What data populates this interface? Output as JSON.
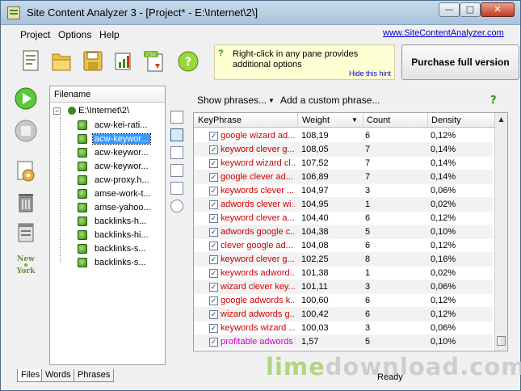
{
  "window": {
    "title": "Site Content Analyzer 3 - [Project* - E:\\Internet\\2\\]",
    "buttons": {
      "minimize": "—",
      "maximize": "□",
      "close": "✕"
    }
  },
  "menu": {
    "items": [
      "Project",
      "Options",
      "Help"
    ],
    "site_link": "www.SiteContentAnalyzer.com"
  },
  "toolbar": {
    "icons": [
      "new-project-icon",
      "open-folder-icon",
      "save-icon",
      "reports-icon",
      "export-csv-icon",
      "help-icon"
    ],
    "help_glyph": "?"
  },
  "hint": {
    "text": "Right-click in any pane provides additional options",
    "hide_label": "Hide this hint",
    "icon": "?"
  },
  "purchase_label": "Purchase full version",
  "left_toolbar": {
    "icons": [
      "play-icon",
      "stop-icon",
      "settings-icon",
      "trash-icon",
      "list-icon",
      "new-york-icon"
    ],
    "ny_label_1": "New",
    "ny_label_2": "York"
  },
  "file_pane": {
    "header": "Filename",
    "root": "E:\\Internet\\2\\",
    "files": [
      "acw-kei-rati...",
      "acw-keywor...",
      "acw-keywor...",
      "acw-keywor...",
      "acw-proxy.h...",
      "amse-work-t...",
      "amse-yahoo...",
      "backlinks-h...",
      "backlinks-hi...",
      "backlinks-s...",
      "backlinks-s..."
    ],
    "selected_index": 1
  },
  "bottom_tabs": [
    "Files",
    "Words",
    "Phrases"
  ],
  "phrases": {
    "show_label": "Show phrases...",
    "add_label": "Add a custom phrase...",
    "help": "?",
    "columns": [
      "KeyPhrase",
      "Weight",
      "Count",
      "Density"
    ],
    "rows": [
      {
        "phrase": "google wizard ad...",
        "weight": "108,19",
        "count": "6",
        "density": "0,12%",
        "color": "#cc0000"
      },
      {
        "phrase": "keyword clever g...",
        "weight": "108,05",
        "count": "7",
        "density": "0,14%",
        "color": "#cc0000"
      },
      {
        "phrase": "keyword wizard cl...",
        "weight": "107,52",
        "count": "7",
        "density": "0,14%",
        "color": "#cc0000"
      },
      {
        "phrase": "google clever ad...",
        "weight": "106,89",
        "count": "7",
        "density": "0,14%",
        "color": "#cc0000"
      },
      {
        "phrase": "keywords clever ...",
        "weight": "104,97",
        "count": "3",
        "density": "0,06%",
        "color": "#cc0000"
      },
      {
        "phrase": "adwords clever wi...",
        "weight": "104,95",
        "count": "1",
        "density": "0,02%",
        "color": "#cc0000"
      },
      {
        "phrase": "keyword clever a...",
        "weight": "104,40",
        "count": "6",
        "density": "0,12%",
        "color": "#cc0000"
      },
      {
        "phrase": "adwords google c...",
        "weight": "104,38",
        "count": "5",
        "density": "0,10%",
        "color": "#cc0000"
      },
      {
        "phrase": "clever google ad...",
        "weight": "104,08",
        "count": "6",
        "density": "0,12%",
        "color": "#cc0000"
      },
      {
        "phrase": "keyword clever g...",
        "weight": "102,25",
        "count": "8",
        "density": "0,16%",
        "color": "#cc0000"
      },
      {
        "phrase": "keywords adword...",
        "weight": "101,38",
        "count": "1",
        "density": "0,02%",
        "color": "#cc0000"
      },
      {
        "phrase": "wizard clever key...",
        "weight": "101,11",
        "count": "3",
        "density": "0,06%",
        "color": "#cc0000"
      },
      {
        "phrase": "google adwords k...",
        "weight": "100,60",
        "count": "6",
        "density": "0,12%",
        "color": "#cc0000"
      },
      {
        "phrase": "wizard adwords g...",
        "weight": "100,42",
        "count": "6",
        "density": "0,12%",
        "color": "#cc0000"
      },
      {
        "phrase": "keywords wizard ...",
        "weight": "100,03",
        "count": "3",
        "density": "0,06%",
        "color": "#cc0000"
      },
      {
        "phrase": "profitable adwords",
        "weight": "1,57",
        "count": "5",
        "density": "0,10%",
        "color": "#cc00cc"
      }
    ]
  },
  "status": "Ready",
  "watermark": {
    "part1": "lime",
    "part2": "download.com"
  }
}
